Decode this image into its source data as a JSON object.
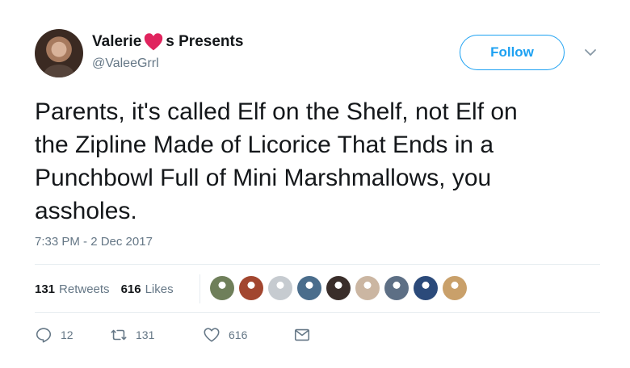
{
  "author": {
    "name_left": "Valerie",
    "name_right": "s Presents",
    "handle": "@ValeeGrrl"
  },
  "follow_label": "Follow",
  "tweet_text": "Parents, it's called Elf on the Shelf, not Elf on\nthe Zipline Made of Licorice That Ends in a\nPunchbowl Full of Mini Marshmallows, you\nassholes.",
  "timestamp": "7:33 PM - 2 Dec 2017",
  "stats": {
    "retweets_count": "131",
    "retweets_label": "Retweets",
    "likes_count": "616",
    "likes_label": "Likes"
  },
  "likers_colors": [
    "#6f7f5a",
    "#a2462f",
    "#c6cbd0",
    "#4a6d8c",
    "#3a2e2a",
    "#cbb6a2",
    "#5d6f85",
    "#2b4a7a",
    "#c9a06a"
  ],
  "actions": {
    "reply_count": "12",
    "retweet_count": "131",
    "like_count": "616"
  },
  "colors": {
    "accent": "#1da1f2",
    "heart": "#e0245e",
    "muted": "#657786",
    "text": "#14171a"
  },
  "icons": [
    "heart-emoji-icon",
    "chevron-down-icon",
    "reply-icon",
    "retweet-icon",
    "like-icon",
    "message-icon"
  ]
}
